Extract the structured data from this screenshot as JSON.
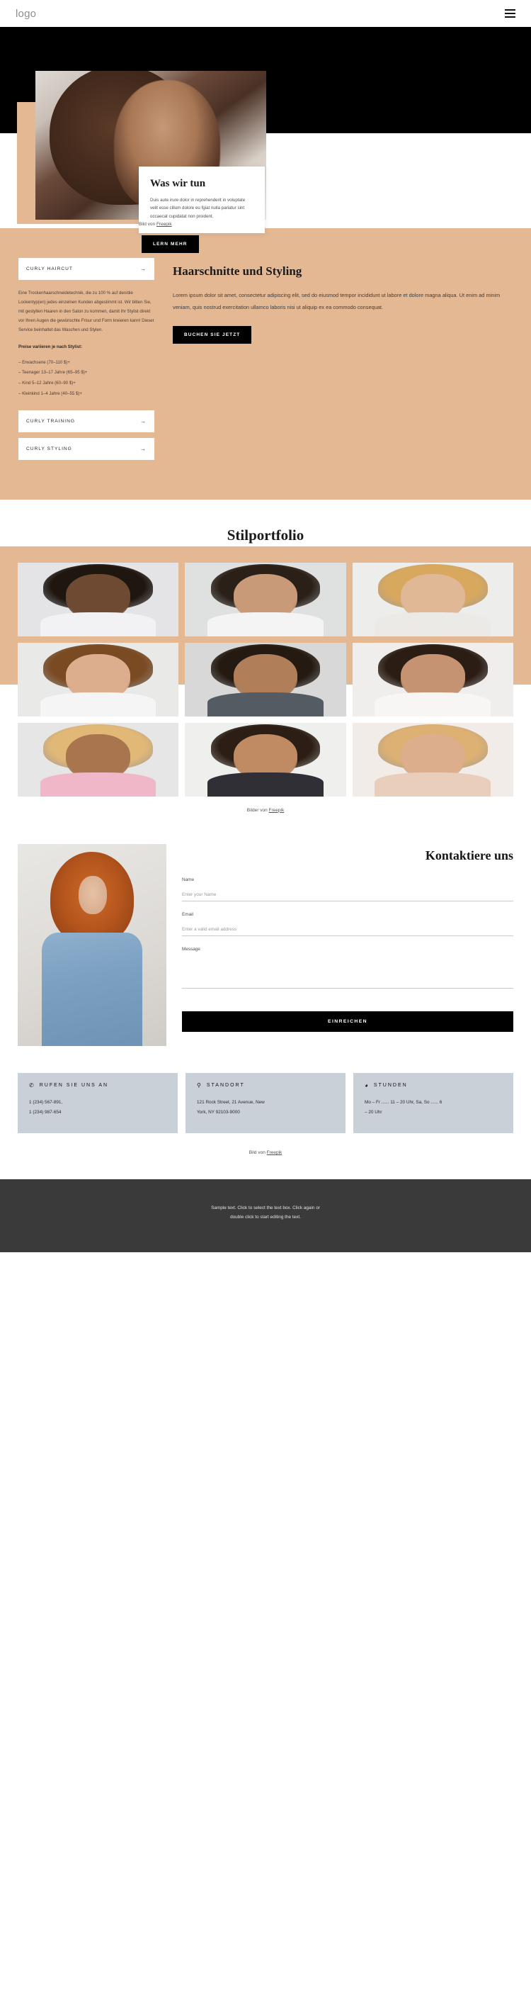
{
  "header": {
    "logo": "logo",
    "menu_icon": "hamburger-menu-icon"
  },
  "hero": {
    "card_title": "Was wir tun",
    "card_text": "Duis aute irure dolor in reprehenderit in voluptate velit esse cillum dolore eu fgiat nulla pariatur sint occaecat cupidatat non proident.",
    "credit_prefix": "Bild von ",
    "credit_link": "Freepik",
    "cta_label": "LERN MEHR"
  },
  "services": {
    "accordion_open": {
      "label": "CURLY HAIRCUT",
      "arrow": "→"
    },
    "body_text": "Eine Trockenhaarschneidetechnik, die zu 100 % auf den/die Lockentyp(en) jedes einzelnen Kunden abgestimmt ist. Wir bitten Sie, mit gestylten Haaren in den Salon zu kommen, damit Ihr Stylist direkt vor Ihren Augen die gewünschte Frisur und Form kreieren kann! Dieser Service beinhaltet das Waschen und Stylen.",
    "price_heading": "Preise variieren je nach Stylist:",
    "prices": [
      "– Erwachsene (70–110 $)+",
      "– Teenager 13–17 Jahre (65–95 $)+",
      "– Kind 5–12 Jahre (60–90 $)+",
      "– Kleinkind 1–4 Jahre (40–55 $)+"
    ],
    "accordion_items": [
      {
        "label": "CURLY TRAINING",
        "arrow": "→"
      },
      {
        "label": "CURLY STYLING",
        "arrow": "→"
      }
    ],
    "heading": "Haarschnitte und Styling",
    "paragraph": "Lorem ipsum dolor sit amet, consectetur adipiscing elit, sed do eiusmod tempor incididunt ut labore et dolore magna aliqua. Ut enim ad minim veniam, quis nostrud exercitation ullamco laboris nisi ut aliquip ex ea commodo consequat.",
    "cta_label": "BUCHEN SIE JETZT"
  },
  "portfolio": {
    "title": "Stilportfolio",
    "credit_prefix": "Bilder von ",
    "credit_link": "Freepik",
    "items": [
      {
        "name": "portfolio-photo-1",
        "bg": "#e4e4e6",
        "hair": "#1f1610",
        "face": "#6f4a33",
        "body": "#f2f2f4"
      },
      {
        "name": "portfolio-photo-2",
        "bg": "#dfe0e0",
        "hair": "#2a2018",
        "face": "#c99a78",
        "body": "#f4f4f5"
      },
      {
        "name": "portfolio-photo-3",
        "bg": "#ededec",
        "hair": "#d9a85f",
        "face": "#e0b896",
        "body": "#eceae7"
      },
      {
        "name": "portfolio-photo-4",
        "bg": "#e9e9e8",
        "hair": "#7a4a22",
        "face": "#dcae8e",
        "body": "#f5f5f5"
      },
      {
        "name": "portfolio-photo-5",
        "bg": "#d8d8d8",
        "hair": "#241a12",
        "face": "#b07f59",
        "body": "#555b63"
      },
      {
        "name": "portfolio-photo-6",
        "bg": "#f0eeec",
        "hair": "#2b1d14",
        "face": "#c59372",
        "body": "#f7f6f5"
      },
      {
        "name": "portfolio-photo-7",
        "bg": "#e6e6e6",
        "hair": "#e2b877",
        "face": "#a9754f",
        "body": "#f0b7c8"
      },
      {
        "name": "portfolio-photo-8",
        "bg": "#efefee",
        "hair": "#2c1e14",
        "face": "#c08b63",
        "body": "#2f2f35"
      },
      {
        "name": "portfolio-photo-9",
        "bg": "#f1ece7",
        "hair": "#ddb173",
        "face": "#dcae8b",
        "body": "#e9cfbb"
      }
    ]
  },
  "contact": {
    "heading": "Kontaktiere uns",
    "fields": [
      {
        "label": "Name",
        "placeholder": "Enter your Name",
        "value": "",
        "name": "name-field"
      },
      {
        "label": "Email",
        "placeholder": "Enter a valid email address",
        "value": "",
        "name": "email-field"
      },
      {
        "label": "Message",
        "placeholder": "",
        "value": "",
        "name": "message-field"
      }
    ],
    "submit_label": "EINREICHEN"
  },
  "info_cards": [
    {
      "icon": "phone-icon",
      "glyph": "✆",
      "title": "RUFEN SIE UNS AN",
      "lines": [
        "1 (234) 567-891,",
        "1 (234) 987-654"
      ]
    },
    {
      "icon": "location-pin-icon",
      "glyph": "⚲",
      "title": "STANDORT",
      "lines": [
        "121 Rock Street, 21 Avenue, New",
        "York, NY 92103-9000"
      ]
    },
    {
      "icon": "clock-icon",
      "glyph": "◕",
      "title": "STUNDEN",
      "lines": [
        "Mo – Fr ...... 11 – 20 Uhr, Sa, So ...... 6",
        "– 20 Uhr"
      ]
    }
  ],
  "bottom_credit": {
    "prefix": "Bild von ",
    "link": "Freepik"
  },
  "footer": {
    "line1": "Sample text. Click to select the text box. Click again or",
    "line2": "double click to start editing the text."
  },
  "colors": {
    "beige": "#e5b894",
    "dark": "#000000",
    "footer": "#3a3a3a",
    "info_card": "#c9d0d8"
  }
}
